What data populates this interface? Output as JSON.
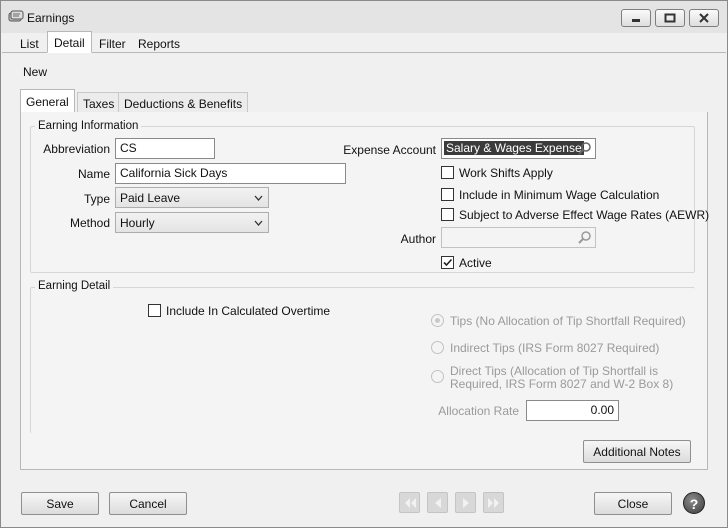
{
  "window": {
    "title": "Earnings"
  },
  "top_tabs": [
    "List",
    "Detail",
    "Filter",
    "Reports"
  ],
  "new_label": "New",
  "inner_tabs": [
    "General",
    "Taxes",
    "Deductions & Benefits"
  ],
  "earning_info": {
    "group_label": "Earning Information",
    "abbreviation_label": "Abbreviation",
    "abbreviation_value": "CS",
    "name_label": "Name",
    "name_value": "California Sick Days",
    "type_label": "Type",
    "type_value": "Paid Leave",
    "method_label": "Method",
    "method_value": "Hourly",
    "expense_label": "Expense Account",
    "expense_value": "Salary & Wages Expense",
    "work_shifts_label": "Work Shifts Apply",
    "work_shifts_checked": false,
    "min_wage_label": "Include in Minimum Wage Calculation",
    "min_wage_checked": false,
    "aewr_label": "Subject to Adverse Effect Wage Rates (AEWR)",
    "aewr_checked": false,
    "author_label": "Author",
    "author_value": "",
    "active_label": "Active",
    "active_checked": true
  },
  "earning_detail": {
    "group_label": "Earning Detail",
    "overtime_label": "Include In Calculated Overtime",
    "overtime_checked": false,
    "tips_label": "Tips (No Allocation of Tip Shortfall Required)",
    "indirect_tips_label": "Indirect Tips (IRS Form 8027 Required)",
    "direct_tips_line1": "Direct Tips (Allocation of Tip Shortfall is",
    "direct_tips_line2": "Required, IRS Form 8027 and W-2 Box 8)",
    "allocation_label": "Allocation Rate",
    "allocation_value": "0.00"
  },
  "buttons": {
    "additional_notes": "Additional Notes",
    "save": "Save",
    "cancel": "Cancel",
    "close": "Close"
  },
  "icons": {
    "app": "scroll-icon",
    "search": "magnifier-icon",
    "help": "question-icon",
    "nav": [
      "first-record-icon",
      "previous-record-icon",
      "next-record-icon",
      "last-record-icon"
    ]
  }
}
